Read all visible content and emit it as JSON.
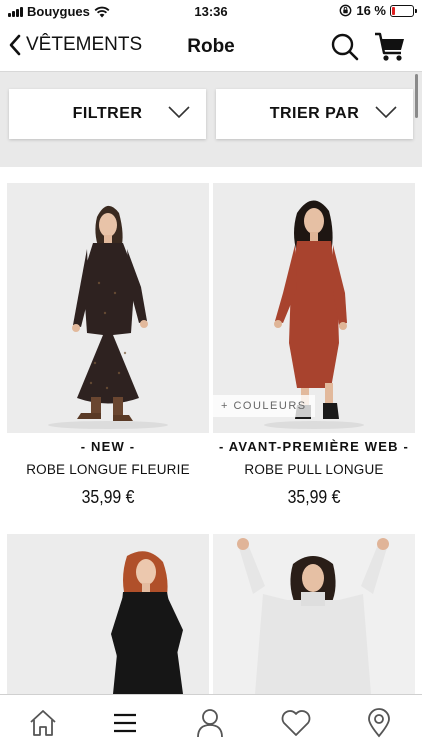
{
  "status_bar": {
    "carrier": "Bouygues",
    "time": "13:36",
    "battery_percent": "16 %",
    "battery_level": 0.16,
    "icons": [
      "signal-icon",
      "wifi-icon",
      "orientation-lock-icon",
      "battery-icon"
    ]
  },
  "nav": {
    "back_label": "VÊTEMENTS",
    "title": "Robe",
    "icons": [
      "chevron-left-icon",
      "search-icon",
      "cart-icon"
    ]
  },
  "filters": {
    "filter_label": "FILTRER",
    "sort_label": "TRIER PAR",
    "icons": [
      "chevron-down-icon"
    ]
  },
  "products": [
    {
      "tag": "- NEW -",
      "name": "ROBE LONGUE FLEURIE",
      "price": "35,99 €",
      "colors_badge": "",
      "dress_color": "#2e2220"
    },
    {
      "tag": "- AVANT-PREMIÈRE WEB -",
      "name": "ROBE PULL LONGUE",
      "price": "35,99 €",
      "colors_badge": "+ COULEURS",
      "dress_color": "#a8432e"
    },
    {
      "tag": "",
      "name": "",
      "price": "",
      "colors_badge": "",
      "dress_color": "#161616"
    },
    {
      "tag": "",
      "name": "",
      "price": "",
      "colors_badge": "",
      "dress_color": "#e6e6e6"
    }
  ],
  "tab_bar": {
    "icons": [
      "home-icon",
      "menu-icon",
      "account-icon",
      "heart-icon",
      "location-icon"
    ]
  },
  "colors": {
    "photo_background": "#ececec",
    "filter_background": "#e9e9e9",
    "battery_low": "#e02020"
  }
}
